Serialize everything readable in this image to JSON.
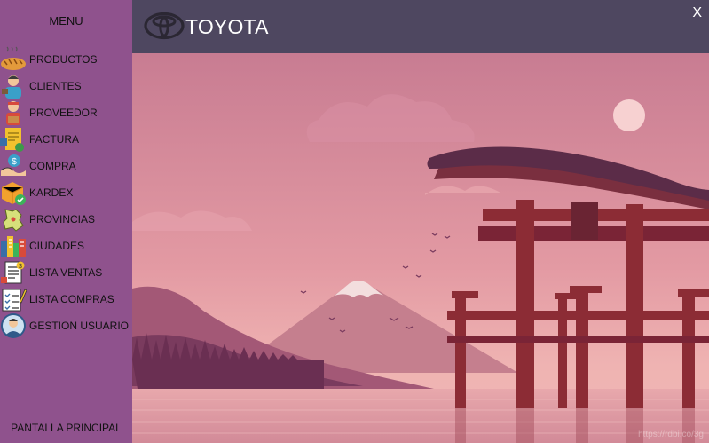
{
  "sidebar": {
    "title": "MENU",
    "items": [
      {
        "label": "PRODUCTOS",
        "icon": "bread-icon"
      },
      {
        "label": "CLIENTES",
        "icon": "customer-icon"
      },
      {
        "label": "PROVEEDOR",
        "icon": "supplier-icon"
      },
      {
        "label": "FACTURA",
        "icon": "invoice-icon"
      },
      {
        "label": "COMPRA",
        "icon": "handshake-icon"
      },
      {
        "label": "KARDEX",
        "icon": "box-check-icon"
      },
      {
        "label": "PROVINCIAS",
        "icon": "map-region-icon"
      },
      {
        "label": "CIUDADES",
        "icon": "city-icon"
      },
      {
        "label": "LISTA VENTAS",
        "icon": "sales-list-icon"
      },
      {
        "label": "LISTA COMPRAS",
        "icon": "purchase-list-icon"
      },
      {
        "label": "GESTION USUARIO",
        "icon": "user-manager-icon"
      }
    ],
    "bottom_label": "PANTALLA PRINCIPAL"
  },
  "header": {
    "brand": "TOYOTA",
    "brand_icon": "toyota-logo-icon",
    "close_label": "X"
  },
  "scene": {
    "watermark": "https://rdbi.co/3g"
  },
  "colors": {
    "sidebar": "#8f528d",
    "header": "#4e4760",
    "sky_top": "#c87c92",
    "sky_bottom": "#e8a3a8",
    "gate": "#8c2c35"
  }
}
